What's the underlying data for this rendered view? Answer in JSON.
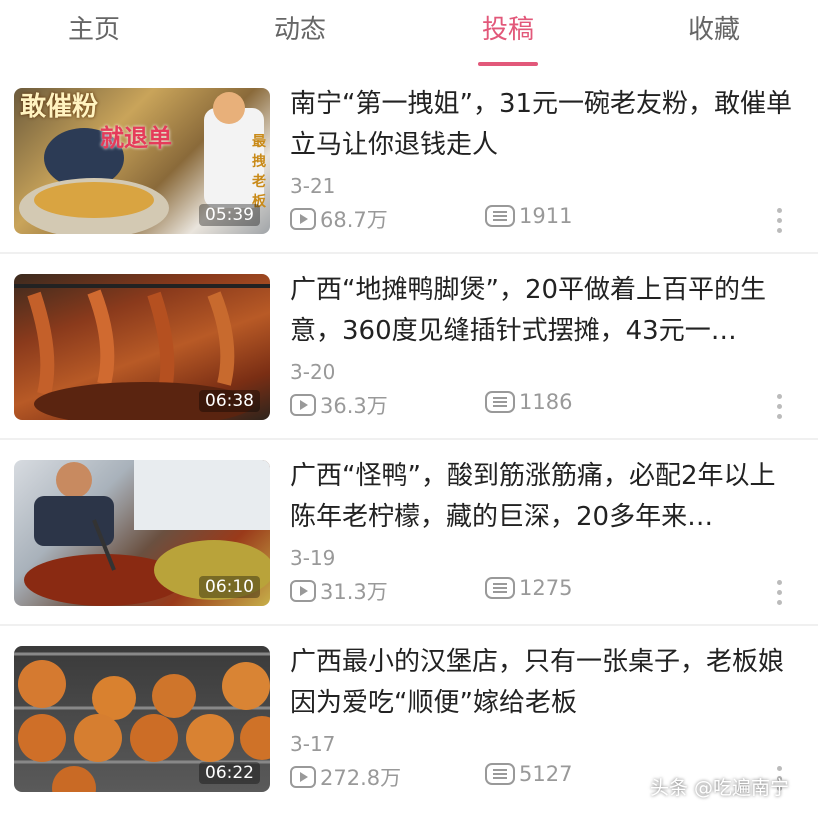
{
  "tabs": [
    {
      "label": "主页"
    },
    {
      "label": "动态"
    },
    {
      "label": "投稿"
    },
    {
      "label": "收藏"
    }
  ],
  "active_tab": "投稿",
  "videos": [
    {
      "title": "南宁“第一拽姐”，31元一碗老友粉，敢催单立马让你退钱走人",
      "date": "3-21",
      "views": "68.7万",
      "comments": "1911",
      "duration": "05:39",
      "thumb_text": [
        "敢催粉",
        "就退单",
        "最拽老板"
      ]
    },
    {
      "title": "广西“地摊鸭脚煲”，20平做着上百平的生意，360度见缝插针式摆摊，43元一…",
      "date": "3-20",
      "views": "36.3万",
      "comments": "1186",
      "duration": "06:38"
    },
    {
      "title": "广西“怪鸭”，酸到筋涨筋痛，必配2年以上陈年老柠檬，藏的巨深，20多年来…",
      "date": "3-19",
      "views": "31.3万",
      "comments": "1275",
      "duration": "06:10"
    },
    {
      "title": "广西最小的汉堡店，只有一张桌子，老板娘因为爱吃“顺便”嫁给老板",
      "date": "3-17",
      "views": "272.8万",
      "comments": "5127",
      "duration": "06:22"
    }
  ],
  "watermark": "头条 @吃遍南宁",
  "colors": {
    "accent": "#e2587a",
    "meta": "#999999",
    "title": "#222222"
  },
  "icons": {
    "views": "play-icon",
    "comments": "comment-icon",
    "more": "more-vertical-icon"
  }
}
